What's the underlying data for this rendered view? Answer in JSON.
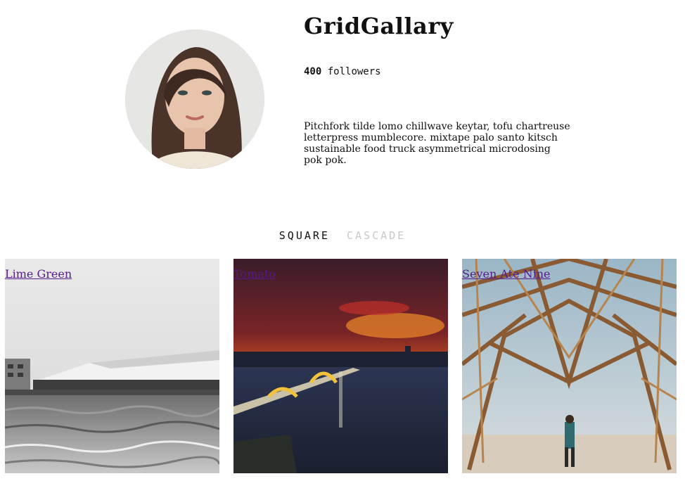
{
  "profile": {
    "name": "GridGallary",
    "followers_count": "400",
    "followers_label": "followers",
    "bio": "Pitchfork tilde lomo chillwave keytar, tofu chartreuse letterpress mumblecore. mixtape palo santo kitsch sustainable food truck asymmetrical microdosing pok pok."
  },
  "tabs": [
    {
      "label": "SQUARE",
      "active": true
    },
    {
      "label": "CASCADE",
      "active": false
    }
  ],
  "gallery": [
    {
      "label": "Lime Green"
    },
    {
      "label": "Tomato"
    },
    {
      "label": "Seven Ate Nine"
    }
  ],
  "colors": {
    "link": "#551a8b",
    "tab_active": "#111111",
    "tab_inactive": "#c8c8c8"
  }
}
